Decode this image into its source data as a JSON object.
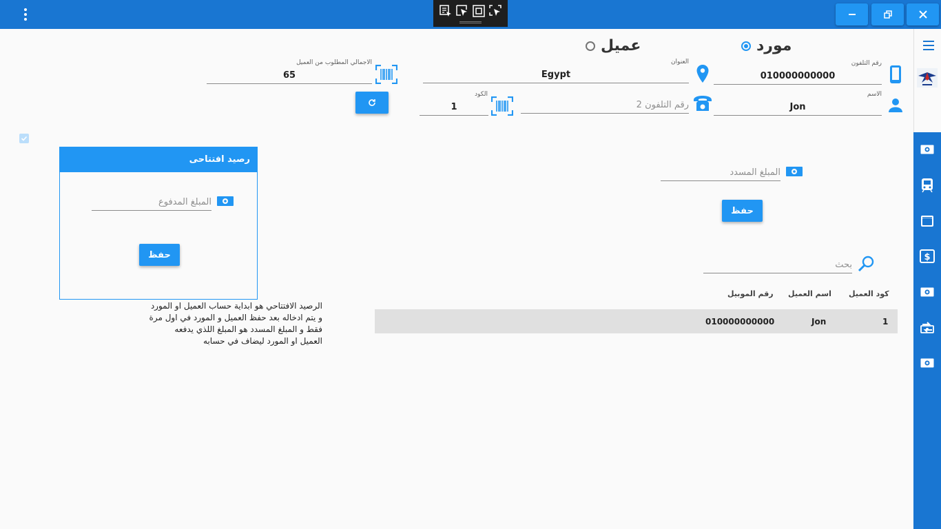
{
  "titlebar": {
    "menu_icon": "more-vert-icon",
    "minimize_icon": "minimize-icon",
    "restore_icon": "restore-icon",
    "close_icon": "close-icon"
  },
  "devtools": [
    "inspect-icon",
    "select-pointer-icon",
    "frame-icon",
    "screenshot-pointer-icon"
  ],
  "account_type": {
    "supplier_label": "مورد",
    "customer_label": "عميل",
    "selected": "supplier"
  },
  "fields": {
    "phone": {
      "label": "رقم التلفون",
      "value": "010000000000"
    },
    "address": {
      "label": "العنوان",
      "value": "Egypt"
    },
    "total_required": {
      "label": "الاجمالي المطلوب من العميل",
      "value": "65"
    },
    "name": {
      "label": "الاسم",
      "value": "Jon"
    },
    "phone2": {
      "placeholder": "رقم التلفون 2"
    },
    "code": {
      "label": "الكود",
      "value": "1"
    },
    "paid_amount": {
      "placeholder": "المبلغ المسدد"
    },
    "search": {
      "placeholder": "بحث"
    }
  },
  "save_label": "حفظ",
  "opening_balance": {
    "title": "رصيد افتتاحى",
    "amount_placeholder": "المبلغ المدفوع",
    "save_label": "حفظ"
  },
  "note_lines": [
    "الرصيد الافتتاحي هو ابداية حساب العميل او المورد",
    "و يتم ادخاله بعد حفظ العميل و المورد في اول مرة",
    "فقط و المبلغ المسدد هو المبلغ اللذي يدفعه",
    "العميل او المورد  ليضاف في حسابه"
  ],
  "table": {
    "headers": [
      "كود العميل",
      "اسم العميل",
      "رقم الموبيل"
    ],
    "rows": [
      {
        "code": "1",
        "name": "Jon",
        "mobile": "010000000000"
      }
    ]
  },
  "sidebar_icons": [
    "money-icon",
    "tram-icon",
    "wallet-card-icon",
    "dollar-bill-icon",
    "money-icon",
    "money-transfer-icon",
    "money-icon"
  ],
  "colors": {
    "primary": "#1976d2",
    "accent": "#2196f3",
    "background": "#fafafa"
  }
}
